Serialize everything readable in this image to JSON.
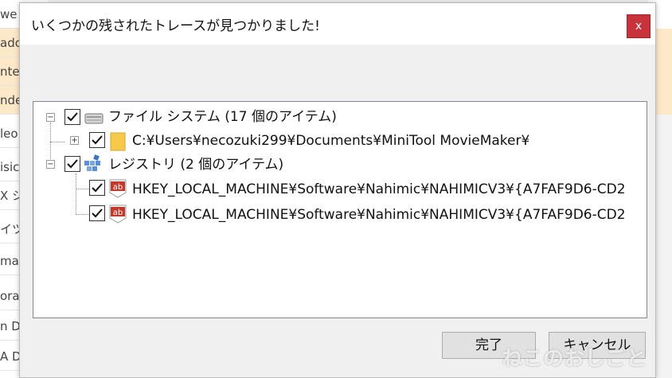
{
  "background_list": {
    "rows": [
      "we",
      "ado",
      "nter",
      "nde",
      "leo",
      "isic",
      "X シ",
      "イツ",
      "mat",
      "orag",
      "n De",
      "A D"
    ]
  },
  "dialog": {
    "title": "いくつかの残されたトレースが見つかりました!",
    "close_label": "x",
    "tree": {
      "file_system": {
        "label": "ファイル システム (17 個のアイテム)",
        "child": "C:¥Users¥necozuki299¥Documents¥MiniTool MovieMaker¥"
      },
      "registry": {
        "label": "レジストリ (2 個のアイテム)",
        "children": [
          "HKEY_LOCAL_MACHINE¥Software¥Nahimic¥NAHIMICV3¥{A7FAF9D6-CD2",
          "HKEY_LOCAL_MACHINE¥Software¥Nahimic¥NAHIMICV3¥{A7FAF9D6-CD2"
        ]
      }
    },
    "buttons": {
      "ok": "完了",
      "cancel": "キャンセル"
    }
  },
  "watermark": "ねこのおしごと",
  "colors": {
    "close_bg": "#c8323a",
    "highlight_row": "#fde8c8",
    "folder": "#f6c94a",
    "reg_icon": "#c0392b"
  }
}
